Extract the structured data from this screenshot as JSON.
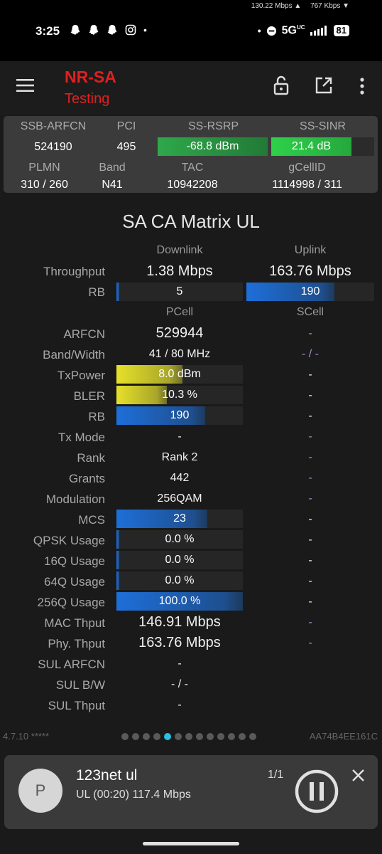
{
  "status": {
    "net_down": "130.22 Mbps ▲",
    "net_up": "767 Kbps ▼",
    "time": "3:25",
    "notif_icons": [
      "snapchat-icon",
      "snapchat-icon",
      "snapchat-icon",
      "instagram-icon"
    ],
    "dot": "•",
    "network": "5G",
    "network_sup": "UC",
    "battery": "81"
  },
  "appbar": {
    "title": "NR-SA",
    "subtitle": "Testing",
    "icons": [
      "menu-icon",
      "lock-icon",
      "external-link-icon",
      "more-vert-icon"
    ],
    "title_color": "#e02020"
  },
  "summary": {
    "labels": {
      "arfcn": "SSB-ARFCN",
      "pci": "PCI",
      "rsrp": "SS-RSRP",
      "sinr": "SS-SINR",
      "plmn": "PLMN",
      "band": "Band",
      "tac": "TAC",
      "gcellid": "gCellID"
    },
    "values": {
      "arfcn": "524190",
      "pci": "495",
      "rsrp": "-68.8 dBm",
      "sinr": "21.4 dB",
      "plmn": "310 / 260",
      "band": "N41",
      "tac": "10942208",
      "gcellid": "1114998 / 311"
    },
    "rsrp_color": "#2fa84a",
    "sinr_color": "#2ed14a"
  },
  "matrix": {
    "title": "SA CA Matrix UL",
    "headers": {
      "downlink": "Downlink",
      "uplink": "Uplink",
      "pcell": "PCell",
      "scell": "SCell"
    },
    "throughput": {
      "label": "Throughput",
      "dl": "1.38 Mbps",
      "ul": "163.76 Mbps"
    },
    "rb_top": {
      "label": "RB",
      "dl": "5",
      "ul": "190",
      "dl_fill": 0.01,
      "ul_fill": 0.69
    },
    "rows": [
      {
        "label": "ARFCN",
        "pcell": "529944",
        "scell": "-"
      },
      {
        "label": "Band/Width",
        "pcell": "41 / 80 MHz",
        "scell": "- / -"
      },
      {
        "label": "TxPower",
        "pcell": "8.0 dBm",
        "scell": "-",
        "fill": 0.52
      },
      {
        "label": "BLER",
        "pcell": "10.3 %",
        "scell": "-",
        "fill": 0.4
      },
      {
        "label": "RB",
        "pcell": "190",
        "scell": "-",
        "fill": 0.7
      },
      {
        "label": "Tx Mode",
        "pcell": "-",
        "scell": "-"
      },
      {
        "label": "Rank",
        "pcell": "Rank 2",
        "scell": "-"
      },
      {
        "label": "Grants",
        "pcell": "442",
        "scell": "-"
      },
      {
        "label": "Modulation",
        "pcell": "256QAM",
        "scell": "-"
      },
      {
        "label": "MCS",
        "pcell": "23",
        "scell": "-",
        "fill": 0.72
      },
      {
        "label": "QPSK Usage",
        "pcell": "0.0 %",
        "scell": "-",
        "fill": 0.0
      },
      {
        "label": "16Q Usage",
        "pcell": "0.0 %",
        "scell": "-",
        "fill": 0.0
      },
      {
        "label": "64Q Usage",
        "pcell": "0.0 %",
        "scell": "-",
        "fill": 0.0
      },
      {
        "label": "256Q Usage",
        "pcell": "100.0 %",
        "scell": "-",
        "fill": 1.0
      },
      {
        "label": "MAC Thput",
        "pcell": "146.91 Mbps",
        "scell": "-"
      },
      {
        "label": "Phy. Thput",
        "pcell": "163.76 Mbps",
        "scell": "-"
      },
      {
        "label": "SUL ARFCN",
        "pcell": "-",
        "scell": ""
      },
      {
        "label": "SUL B/W",
        "pcell": "- / -",
        "scell": ""
      },
      {
        "label": "SUL Thput",
        "pcell": "-",
        "scell": ""
      }
    ]
  },
  "footer": {
    "version": "4.7.10 *****",
    "device_id": "AA74B4EE161C",
    "pages_total": 13,
    "page_active": 5
  },
  "media": {
    "avatar_letter": "P",
    "title": "123net ul",
    "subtitle": "UL (00:20) 117.4 Mbps",
    "count": "1/1"
  }
}
